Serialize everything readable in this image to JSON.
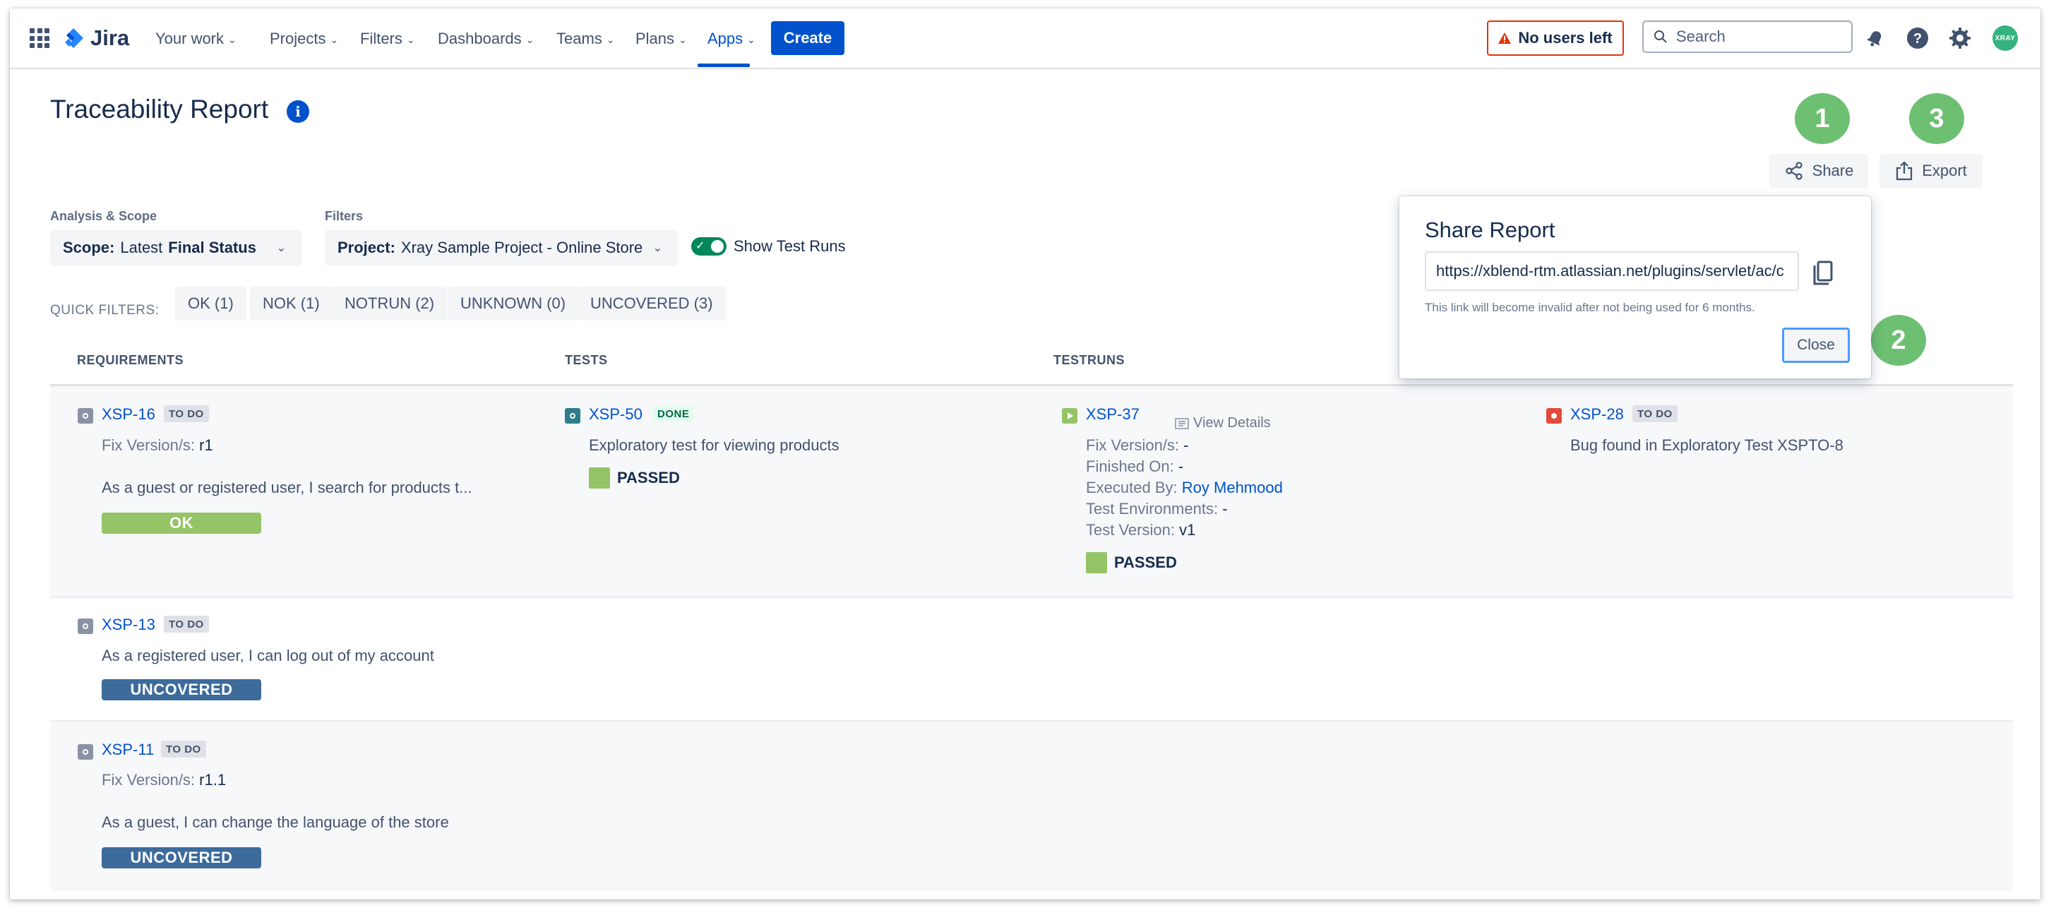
{
  "nav": {
    "logo": "Jira",
    "items": [
      {
        "label": "Your work"
      },
      {
        "label": "Projects"
      },
      {
        "label": "Filters"
      },
      {
        "label": "Dashboards"
      },
      {
        "label": "Teams"
      },
      {
        "label": "Plans"
      },
      {
        "label": "Apps"
      }
    ],
    "active_item": "Apps",
    "create_label": "Create",
    "no_users_label": "No users left",
    "search_placeholder": "Search",
    "avatar_text": "XRAY"
  },
  "page": {
    "title": "Traceability Report",
    "callouts": [
      "1",
      "2",
      "3"
    ],
    "share_label": "Share",
    "export_label": "Export"
  },
  "scope": {
    "label": "Analysis & Scope",
    "key": "Scope:",
    "prefix": "Latest",
    "value": "Final Status"
  },
  "filters": {
    "label": "Filters",
    "key": "Project:",
    "value": "Xray Sample Project - Online Store",
    "toggle_label": "Show Test Runs",
    "toggle_on": true
  },
  "quick_filters": {
    "label": "QUICK FILTERS:",
    "items": [
      "OK (1)",
      "NOK (1)",
      "NOTRUN (2)",
      "UNKNOWN (0)",
      "UNCOVERED (3)"
    ]
  },
  "table": {
    "headers": [
      "REQUIREMENTS",
      "TESTS",
      "TESTRUNS"
    ],
    "rows": [
      {
        "requirement": {
          "key": "XSP-16",
          "status": "TO DO",
          "fix_label": "Fix Version/s:",
          "fix_value": "r1",
          "summary": "As a guest or registered user, I search for products t...",
          "result": "OK"
        },
        "test": {
          "key": "XSP-50",
          "status": "DONE",
          "summary": "Exploratory test for viewing products",
          "result": "PASSED"
        },
        "testrun": {
          "key": "XSP-37",
          "view_details": "View Details",
          "fields": [
            {
              "label": "Fix Version/s:",
              "value": "-"
            },
            {
              "label": "Finished On:",
              "value": "-"
            },
            {
              "label": "Executed By:",
              "value": "Roy Mehmood"
            },
            {
              "label": "Test Environments:",
              "value": "-"
            },
            {
              "label": "Test Version:",
              "value": "v1"
            }
          ],
          "result": "PASSED"
        },
        "defect": {
          "key": "XSP-28",
          "status": "TO DO",
          "summary": "Bug found in Exploratory Test XSPTO-8"
        }
      },
      {
        "requirement": {
          "key": "XSP-13",
          "status": "TO DO",
          "summary": "As a registered user, I can log out of my account",
          "result": "UNCOVERED"
        }
      },
      {
        "requirement": {
          "key": "XSP-11",
          "status": "TO DO",
          "fix_label": "Fix Version/s:",
          "fix_value": "r1.1",
          "summary": "As a guest, I can change the language of the store",
          "result": "UNCOVERED"
        }
      }
    ]
  },
  "share_dialog": {
    "title": "Share Report",
    "url": "https://xblend-rtm.atlassian.net/plugins/servlet/ac/c",
    "help": "This link will become invalid after not being used for 6 months.",
    "close_label": "Close"
  },
  "colors": {
    "primary": "#0052CC",
    "ok": "#95C467",
    "uncovered": "#3D6B9C",
    "callout": "#6DBF72",
    "warning": "#DE350B"
  },
  "icons": [
    "app-switcher-icon",
    "jira-logo-icon",
    "warning-icon",
    "search-icon",
    "notifications-icon",
    "help-icon",
    "settings-icon",
    "info-icon",
    "share-icon",
    "export-icon",
    "copy-icon",
    "issue-type-icon",
    "details-icon",
    "chevron-down-icon"
  ]
}
